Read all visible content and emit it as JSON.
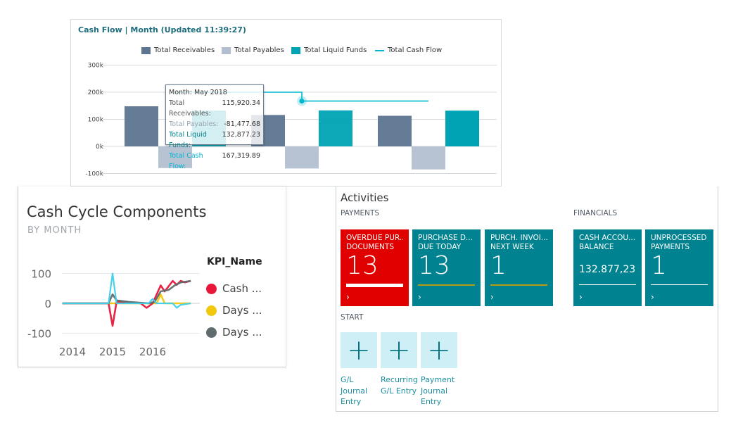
{
  "cash_flow": {
    "title": "Cash Flow | Month (Updated 11:39:27)",
    "legend": [
      {
        "label": "Total Receivables",
        "color": "#5d7590",
        "type": "bar"
      },
      {
        "label": "Total Payables",
        "color": "#b3bfd1",
        "type": "bar"
      },
      {
        "label": "Total Liquid Funds",
        "color": "#00a3b4",
        "type": "bar"
      },
      {
        "label": "Total Cash Flow",
        "color": "#00b7d1",
        "type": "line"
      }
    ],
    "tooltip": {
      "month": "Month: May 2018",
      "rows": [
        {
          "label": "Total Receivables:",
          "value": "115,920.34"
        },
        {
          "label": "Total Payables:",
          "value": "-81,477.68"
        },
        {
          "label": "Total Liquid Funds:",
          "value": "132,877.23"
        },
        {
          "label": "Total Cash Flow:",
          "value": "167,319.89"
        }
      ]
    }
  },
  "chart_data": [
    {
      "type": "bar",
      "title": "Cash Flow | Month (Updated 11:39:27)",
      "y_ticks": [
        "300k",
        "200k",
        "100k",
        "0k",
        "-100k"
      ],
      "ylim": [
        -100000,
        300000
      ],
      "grid": true,
      "legend_position": "top",
      "series": [
        {
          "name": "Total Receivables",
          "values": [
            148000,
            115920.34,
            113000
          ]
        },
        {
          "name": "Total Payables",
          "values": [
            -80000,
            -81477.68,
            -85000
          ]
        },
        {
          "name": "Total Liquid Funds",
          "values": [
            132000,
            132877.23,
            132000
          ]
        },
        {
          "name": "Total Cash Flow",
          "type": "line",
          "values": [
            200000,
            167319.89,
            167319.89
          ]
        }
      ]
    },
    {
      "type": "line",
      "title": "Cash Cycle Components",
      "subtitle": "BY MONTH",
      "legend_title": "KPI_Name",
      "legend_position": "right",
      "x_ticks": [
        "2014",
        "2015",
        "2016"
      ],
      "y_ticks": [
        "100",
        "0",
        "-100"
      ],
      "ylim": [
        -100,
        100
      ],
      "xlim": [
        2013.75,
        2017.0
      ],
      "grid": true,
      "series": [
        {
          "name": "Cash ...",
          "color": "#e8173a",
          "x": [
            2013.75,
            2014.9,
            2015.0,
            2015.1,
            2015.3,
            2015.7,
            2015.85,
            2016.0,
            2016.2,
            2016.3,
            2016.5,
            2016.6,
            2016.7,
            2016.8,
            2016.95
          ],
          "y": [
            0,
            0,
            -75,
            5,
            5,
            0,
            -15,
            0,
            60,
            40,
            75,
            62,
            75,
            70,
            75
          ]
        },
        {
          "name": "Days ...",
          "color": "#f2c80f",
          "x": [
            2013.75,
            2016.1,
            2016.2,
            2016.3,
            2016.95
          ],
          "y": [
            0,
            0,
            30,
            0,
            0
          ]
        },
        {
          "name": "Days ...",
          "color": "#5f6b6d",
          "x": [
            2013.75,
            2014.9,
            2015.0,
            2015.1,
            2015.4,
            2015.9,
            2016.05,
            2016.2,
            2016.4,
            2016.55,
            2016.7,
            2016.95
          ],
          "y": [
            0,
            0,
            30,
            10,
            5,
            0,
            5,
            40,
            45,
            60,
            70,
            75
          ]
        },
        {
          "color": "#3fd0ea",
          "x": [
            2013.75,
            2014.9,
            2015.0,
            2015.1,
            2015.9,
            2016.0,
            2016.1,
            2016.5,
            2016.6,
            2016.7,
            2016.95
          ],
          "y": [
            0,
            0,
            100,
            0,
            0,
            15,
            0,
            0,
            -15,
            -5,
            0
          ]
        }
      ]
    }
  ],
  "activities": {
    "title": "Activities",
    "payments_label": "PAYMENTS",
    "financials_label": "FINANCIALS",
    "start_label": "START",
    "tiles": [
      {
        "line1": "OVERDUE PUR...",
        "line2": "DOCUMENTS",
        "value": "13",
        "color": "#e00000"
      },
      {
        "line1": "PURCHASE D...",
        "line2": "DUE TODAY",
        "value": "13",
        "color": "#008290"
      },
      {
        "line1": "PURCH. INVOI...",
        "line2": "NEXT WEEK",
        "value": "1",
        "color": "#008290"
      },
      {
        "line1": "CASH ACCOU...",
        "line2": "BALANCE",
        "value": "132.877,23",
        "color": "#008290"
      },
      {
        "line1": "UNPROCESSED",
        "line2": "PAYMENTS",
        "value": "1",
        "color": "#008290"
      }
    ],
    "chevron": "›",
    "start_actions": [
      {
        "icon": "plus-icon",
        "glyph": "+",
        "line1": "G/L",
        "line2": "Journal",
        "line3": "Entry"
      },
      {
        "icon": "plus-icon",
        "glyph": "+",
        "line1": "Recurring",
        "line2": "G/L Entry",
        "line3": ""
      },
      {
        "icon": "plus-icon",
        "glyph": "+",
        "line1": "Payment",
        "line2": "Journal",
        "line3": "Entry"
      }
    ]
  }
}
